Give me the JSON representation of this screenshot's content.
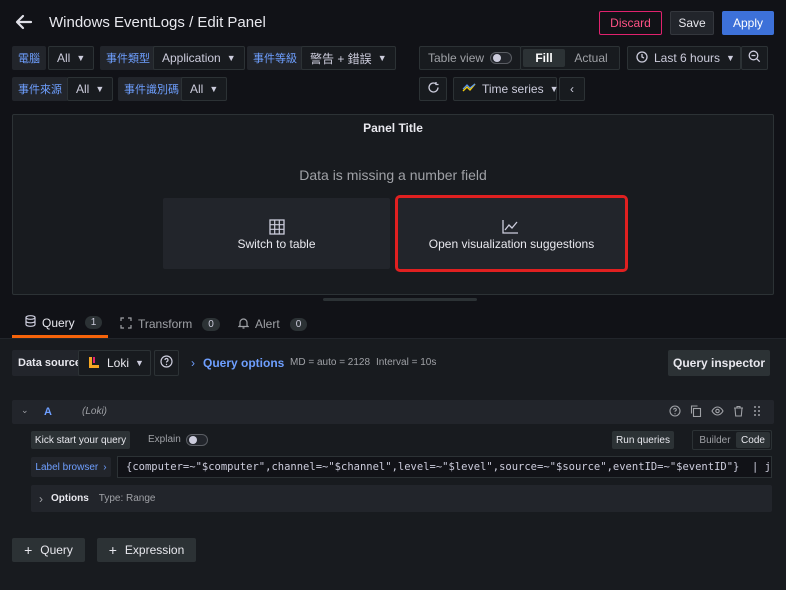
{
  "header": {
    "title": "Windows EventLogs / Edit Panel",
    "discard": "Discard",
    "save": "Save",
    "apply": "Apply"
  },
  "variables": [
    {
      "label": "電腦",
      "value": "All"
    },
    {
      "label": "事件類型",
      "value": "Application"
    },
    {
      "label": "事件等級",
      "value": "警告 + 錯誤"
    },
    {
      "label": "事件來源",
      "value": "All"
    },
    {
      "label": "事件識別碼",
      "value": "All"
    }
  ],
  "toolbar": {
    "table_view": "Table view",
    "fill": "Fill",
    "actual": "Actual",
    "time_range": "Last 6 hours",
    "viz": "Time series"
  },
  "panel": {
    "title": "Panel Title",
    "message": "Data is missing a number field",
    "switch_table": "Switch to table",
    "open_suggestions": "Open visualization suggestions"
  },
  "tabs": [
    {
      "label": "Query",
      "count": "1"
    },
    {
      "label": "Transform",
      "count": "0"
    },
    {
      "label": "Alert",
      "count": "0"
    }
  ],
  "query_bar": {
    "data_source_label": "Data source",
    "data_source": "Loki",
    "query_options": "Query options",
    "md": "MD = auto = 2128",
    "interval": "Interval = 10s",
    "inspector": "Query inspector"
  },
  "query": {
    "ref": "A",
    "ds": "(Loki)",
    "kick_start": "Kick start your query",
    "explain": "Explain",
    "run": "Run queries",
    "builder": "Builder",
    "code": "Code",
    "label_browser": "Label browser",
    "expr_braces_open": "{",
    "expr_parts": [
      {
        "k": "computer",
        "op": "=~",
        "v": "\"$computer\""
      },
      {
        "k": "channel",
        "op": "=~",
        "v": "\"$channel\""
      },
      {
        "k": "level",
        "op": "=~",
        "v": "\"$level\""
      },
      {
        "k": "source",
        "op": "=~",
        "v": "\"$source\""
      },
      {
        "k": "eventID",
        "op": "=~",
        "v": "\"$eventID\""
      }
    ],
    "expr_tail": "} | json",
    "options": "Options",
    "options_type": "Type: Range"
  },
  "footer": {
    "add_query": "Query",
    "add_expression": "Expression"
  },
  "colors": {
    "bg": "#111217",
    "accent": "#3d71d9",
    "discard": "#e0226e",
    "highlight": "#e02020"
  }
}
